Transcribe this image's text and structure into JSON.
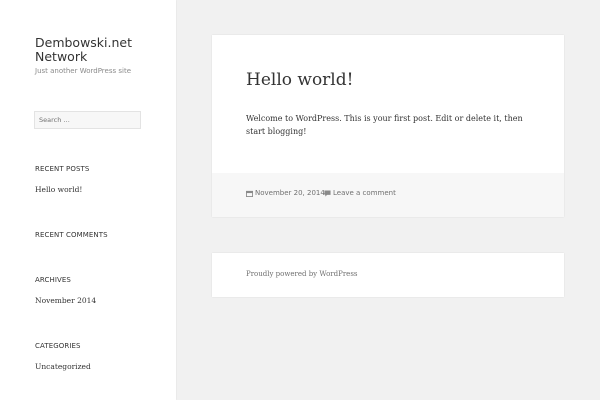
{
  "site": {
    "title": "Dembowski.net Network",
    "description": "Just another WordPress site"
  },
  "search": {
    "placeholder": "Search …"
  },
  "widgets": {
    "recent_posts": {
      "title": "RECENT POSTS",
      "items": [
        "Hello world!"
      ]
    },
    "recent_comments": {
      "title": "RECENT COMMENTS"
    },
    "archives": {
      "title": "ARCHIVES",
      "items": [
        "November 2014"
      ]
    },
    "categories": {
      "title": "CATEGORIES",
      "items": [
        "Uncategorized"
      ]
    }
  },
  "post": {
    "title": "Hello world!",
    "body": "Welcome to WordPress. This is your first post. Edit or delete it, then start blogging!",
    "date": "November 20, 2014",
    "comment_link": "Leave a comment"
  },
  "footer": {
    "powered_by": "Proudly powered by WordPress"
  },
  "icons": {
    "date": "calendar-icon",
    "comment": "comment-icon"
  },
  "colors": {
    "background": "#f1f1f1",
    "panel": "#ffffff",
    "meta_bg": "#f7f7f7",
    "text": "#333333",
    "muted": "#707070"
  }
}
